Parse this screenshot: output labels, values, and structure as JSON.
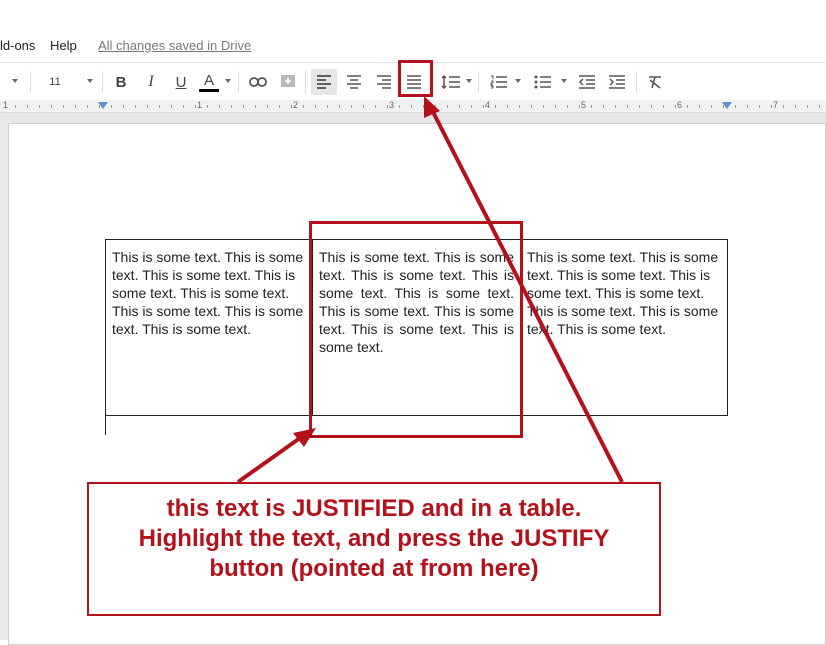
{
  "menu": {
    "addons_label": "ld-ons",
    "help_label": "Help",
    "save_status": "All changes saved in Drive"
  },
  "toolbar": {
    "font_size": "11",
    "bold_label": "B",
    "italic_label": "I",
    "underline_label": "U",
    "text_color_label": "A",
    "text_color": "#000000",
    "active_button": "justify"
  },
  "ruler": {
    "labels": [
      "1",
      "1",
      "2",
      "3",
      "4",
      "5",
      "6",
      "7"
    ]
  },
  "document": {
    "table": {
      "cells": [
        "This is some text. This is some text. This is some text. This is some text. This is some text. This is some text. This is some text. This is some text.",
        "This is some text. This is some text. This is some text. This is some text. This is some text. This is some text. This is some text. This is some text. This is some text.",
        "This is some text. This is some text. This is some text. This is some text. This is some text. This is some text. This is some text. This is some text."
      ]
    }
  },
  "annotation": {
    "callout_line1": "this text is JUSTIFIED and in a table.",
    "callout_line2": "Highlight the text, and press the JUSTIFY",
    "callout_line3": "button (pointed at from here)",
    "color": "#b4121b"
  }
}
